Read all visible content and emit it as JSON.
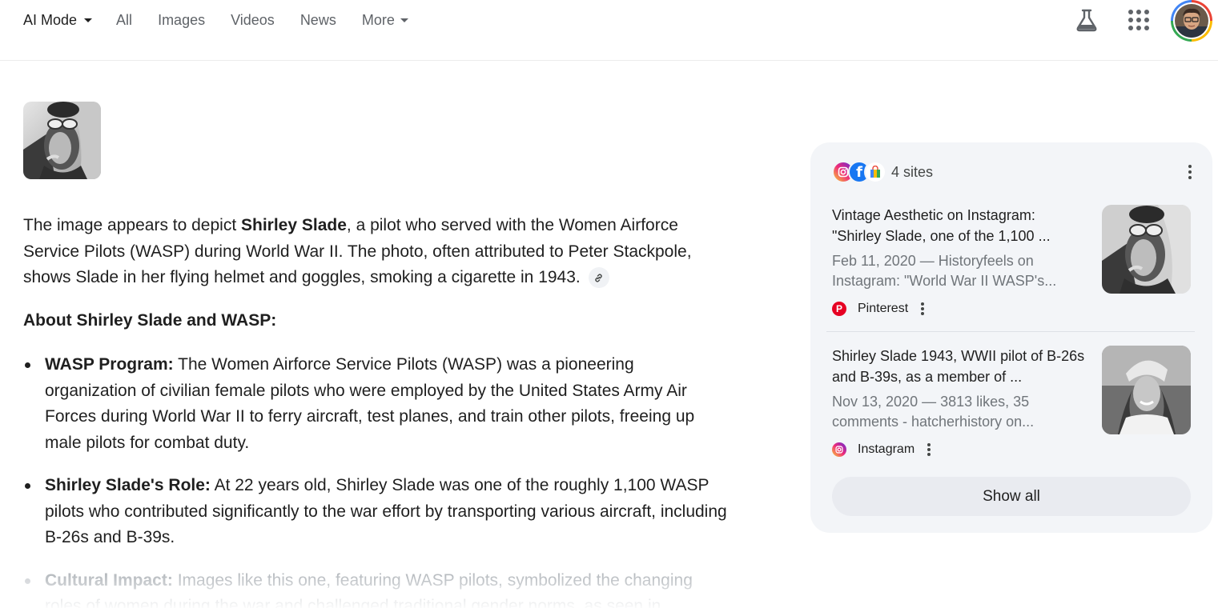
{
  "nav": {
    "tabs": [
      {
        "label": "AI Mode",
        "active": true,
        "dropdown": true
      },
      {
        "label": "All"
      },
      {
        "label": "Images"
      },
      {
        "label": "Videos"
      },
      {
        "label": "News"
      },
      {
        "label": "More",
        "dropdown": true
      }
    ],
    "icons": [
      "labs-flask-icon",
      "apps-grid-icon",
      "account-avatar"
    ]
  },
  "answer": {
    "intro_parts": [
      "The image appears to depict ",
      "Shirley Slade",
      ", a pilot who served with the Women Airforce Service Pilots (WASP) during World War II. The photo, often attributed to Peter Stackpole, shows Slade in her flying helmet and goggles, smoking a cigarette in 1943."
    ],
    "section_title": "About Shirley Slade and WASP:",
    "bullets": [
      {
        "title": "WASP Program:",
        "text": " The Women Airforce Service Pilots (WASP) was a pioneering organization of civilian female pilots who were employed by the United States Army Air Forces during World War II to ferry aircraft, test planes, and train other pilots, freeing up male pilots for combat duty."
      },
      {
        "title": "Shirley Slade's Role:",
        "text": " At 22 years old, Shirley Slade was one of the roughly 1,100 WASP pilots who contributed significantly to the war effort by transporting various aircraft, including B-26s and B-39s."
      },
      {
        "title": "Cultural Impact:",
        "text": " Images like this one, featuring WASP pilots, symbolized the changing roles of women during the war and challenged traditional gender norms, as seen in"
      }
    ]
  },
  "sources": {
    "count_label": "4 sites",
    "items": [
      {
        "title": "Vintage Aesthetic on Instagram: \"Shirley Slade, one of the 1,100 ...",
        "snippet": "Feb 11, 2020 — Historyfeels on Instagram: \"World War II WASP's...",
        "site": "Pinterest"
      },
      {
        "title": "Shirley Slade 1943, WWII pilot of B-26s and B-39s, as a member of ...",
        "snippet": "Nov 13, 2020 — 3813 likes, 35 comments - hatcherhistory on...",
        "site": "Instagram"
      }
    ],
    "show_all": "Show all"
  },
  "colors": {
    "panel_bg": "#f3f5f8",
    "text": "#1f1f1f",
    "muted": "#70757a",
    "google_red": "#ea4335",
    "google_yellow": "#fbbc04",
    "google_green": "#34a853",
    "google_blue": "#4285f4"
  }
}
